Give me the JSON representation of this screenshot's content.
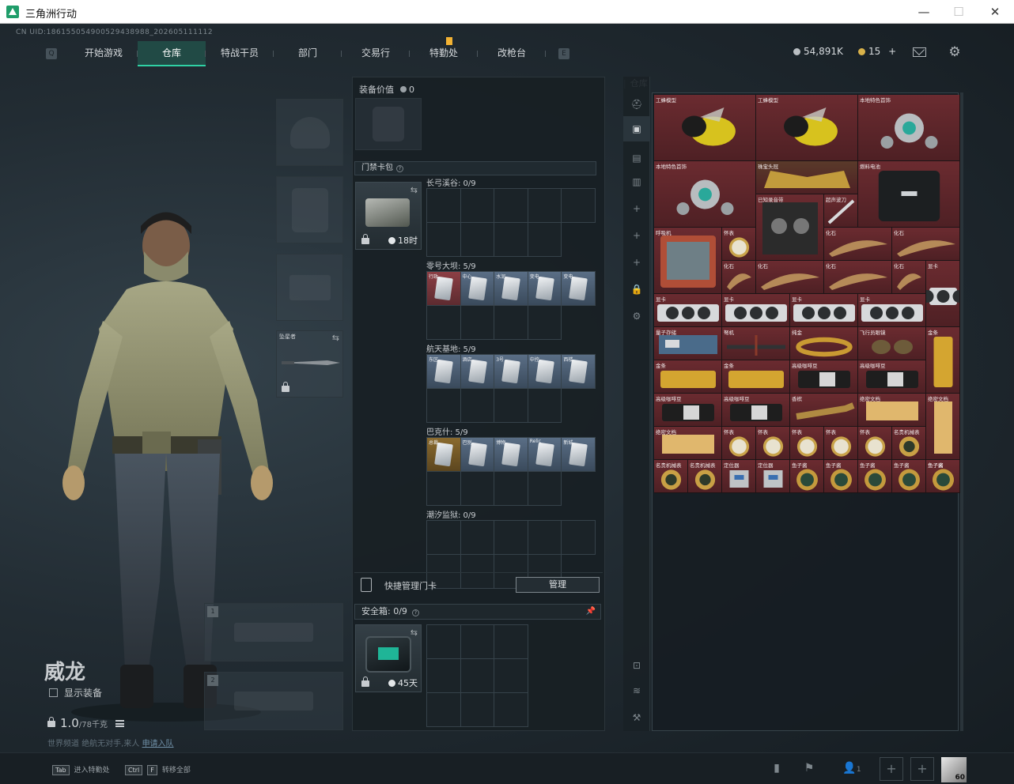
{
  "window": {
    "title": "三角洲行动",
    "minimize": "—",
    "maximize": "☐",
    "close": "✕"
  },
  "uid": "CN UID:186155054900529438988_202605111112",
  "nav": {
    "tabs": [
      {
        "label": "开始游戏"
      },
      {
        "label": "仓库",
        "active": true
      },
      {
        "label": "特战干员"
      },
      {
        "label": "部门"
      },
      {
        "label": "交易行"
      },
      {
        "label": "特勤处",
        "badge": true
      },
      {
        "label": "改枪台"
      }
    ],
    "left_key": "Q",
    "right_key": "E"
  },
  "currency": {
    "silver": "54,891K",
    "gold": "15",
    "gold_plus": "+"
  },
  "colors": {
    "accent": "#2fd1a4",
    "badge": "#f2b233",
    "rare_red": "#7a2a31",
    "gold": "#b08a36"
  },
  "operator": {
    "name": "威龙",
    "show_equipment": "显示装备",
    "weight_value": "1.0",
    "weight_max": "/78千克"
  },
  "equipment_slots": [
    {
      "name": "helmet"
    },
    {
      "name": "armor"
    },
    {
      "name": "pistol"
    },
    {
      "name": "melee",
      "label": "坠星者"
    }
  ],
  "weapon_slots": [
    "1",
    "2"
  ],
  "hint": {
    "prefix": "世界频道",
    "text": "绝航无对手,来人",
    "link": "申请入队"
  },
  "equip_panel": {
    "label": "装备价值",
    "value": "0"
  },
  "keycase": {
    "label": "门禁卡包",
    "q": "?",
    "time": "18时"
  },
  "card_sections": [
    {
      "label": "长弓溪谷: 0/9",
      "cards": []
    },
    {
      "label": "零号大坝: 5/9",
      "cards": [
        {
          "n": "行政",
          "color": "red"
        },
        {
          "n": "中心",
          "color": "blue"
        },
        {
          "n": "水泥",
          "color": "blue"
        },
        {
          "n": "变电",
          "color": "blue"
        },
        {
          "n": "变电",
          "color": "blue"
        }
      ]
    },
    {
      "label": "航天基地: 5/9",
      "cards": [
        {
          "n": "东区",
          "color": "blue"
        },
        {
          "n": "酒店",
          "color": "blue"
        },
        {
          "n": "3号",
          "color": "blue"
        },
        {
          "n": "中控",
          "color": "blue"
        },
        {
          "n": "西楼",
          "color": "blue"
        }
      ]
    },
    {
      "label": "巴克什: 5/9",
      "cards": [
        {
          "n": "总裁",
          "color": "gold"
        },
        {
          "n": "巴别",
          "color": "blue"
        },
        {
          "n": "博物",
          "color": "blue"
        },
        {
          "n": "Relic",
          "color": "blue"
        },
        {
          "n": "新城",
          "color": "blue"
        }
      ]
    },
    {
      "label": "潮汐监狱: 0/9",
      "cards": []
    }
  ],
  "quick_manage": {
    "label": "快捷管理门卡",
    "button": "管理"
  },
  "safebox": {
    "label": "安全箱: 0/9",
    "q": "?",
    "time": "45天"
  },
  "warehouse": {
    "label": "仓库"
  },
  "stash_items": [
    {
      "name": "工蜂模型",
      "kind": "bee"
    },
    {
      "name": "工蜂模型",
      "kind": "bee"
    },
    {
      "name": "本地特色首饰",
      "kind": "jewel"
    },
    {
      "name": "本地特色首饰",
      "kind": "jewel"
    },
    {
      "name": "珠宝头冠",
      "kind": "crown"
    },
    {
      "name": "燃料电池",
      "kind": "battery"
    },
    {
      "name": "已知录音带",
      "kind": "reel"
    },
    {
      "name": "超声波刀",
      "kind": "knife"
    },
    {
      "name": "呼吸机",
      "kind": "device"
    },
    {
      "name": "怀表",
      "kind": "watch"
    },
    {
      "name": "化石",
      "kind": "fossil"
    },
    {
      "name": "化石",
      "kind": "fossil"
    },
    {
      "name": "化石",
      "kind": "fossil"
    },
    {
      "name": "化石",
      "kind": "fossil"
    },
    {
      "name": "化石",
      "kind": "fossil"
    },
    {
      "name": "化石",
      "kind": "fossil"
    },
    {
      "name": "显卡",
      "kind": "gpu"
    },
    {
      "name": "显卡",
      "kind": "gpu"
    },
    {
      "name": "显卡",
      "kind": "gpu"
    },
    {
      "name": "显卡",
      "kind": "gpu"
    },
    {
      "name": "显卡",
      "kind": "gpu"
    },
    {
      "name": "量子存储",
      "kind": "circuit"
    },
    {
      "name": "弩机",
      "kind": "crossbow"
    },
    {
      "name": "纯金",
      "kind": "chain"
    },
    {
      "name": "飞行员眼镜",
      "kind": "glasses"
    },
    {
      "name": "金条",
      "kind": "bar"
    },
    {
      "name": "金条",
      "kind": "goldbar"
    },
    {
      "name": "金条",
      "kind": "goldbar"
    },
    {
      "name": "高级咖啡豆",
      "kind": "coffee"
    },
    {
      "name": "高级咖啡豆",
      "kind": "coffee"
    },
    {
      "name": "高级咖啡豆",
      "kind": "coffee"
    },
    {
      "name": "高级咖啡豆",
      "kind": "coffee"
    },
    {
      "name": "香槟",
      "kind": "bottle"
    },
    {
      "name": "绝密文档",
      "kind": "doc"
    },
    {
      "name": "绝密文档",
      "kind": "doc"
    },
    {
      "name": "绝密文档",
      "kind": "doc"
    },
    {
      "name": "怀表",
      "kind": "watch"
    },
    {
      "name": "怀表",
      "kind": "watch"
    },
    {
      "name": "怀表",
      "kind": "watch"
    },
    {
      "name": "怀表",
      "kind": "watch"
    },
    {
      "name": "怀表",
      "kind": "watch"
    },
    {
      "name": "名贵机械表",
      "kind": "rolex"
    },
    {
      "name": "名贵机械表",
      "kind": "rolex"
    },
    {
      "name": "名贵机械表",
      "kind": "rolex"
    },
    {
      "name": "定位器",
      "kind": "tracker"
    },
    {
      "name": "定位器",
      "kind": "tracker"
    },
    {
      "name": "鱼子酱",
      "kind": "can"
    },
    {
      "name": "鱼子酱",
      "kind": "can"
    },
    {
      "name": "鱼子酱",
      "kind": "can"
    },
    {
      "name": "鱼子酱",
      "kind": "can"
    },
    {
      "name": "鱼子酱",
      "kind": "can"
    },
    {
      "name": "鱼子酱",
      "kind": "can"
    }
  ],
  "bottombar": {
    "hint1_key": "Tab",
    "hint1": "进入特勤处",
    "hint2_key1": "Ctrl",
    "hint2_key2": "F",
    "hint2": "转移全部",
    "friends": "1",
    "avatar_level": "60"
  }
}
